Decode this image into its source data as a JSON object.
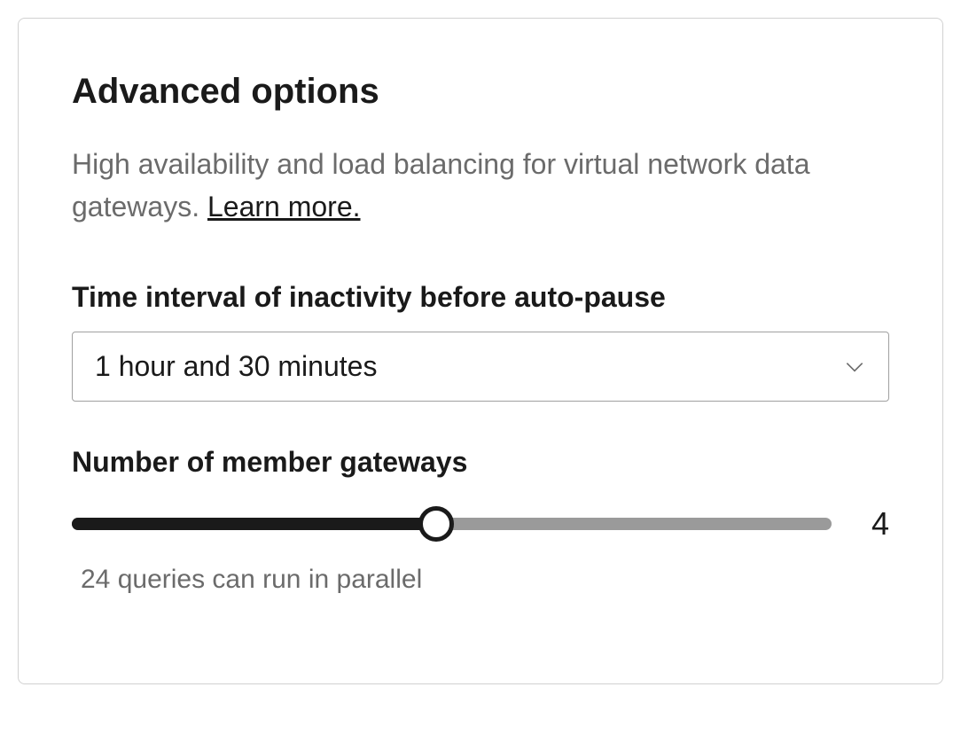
{
  "card": {
    "title": "Advanced options",
    "description_prefix": "High availability and load balancing for virtual network data gateways. ",
    "learn_more_label": "Learn more."
  },
  "time_interval": {
    "label": "Time interval of inactivity before auto-pause",
    "selected_value": "1 hour and 30 minutes"
  },
  "member_gateways": {
    "label": "Number of member gateways",
    "value": "4",
    "helper_text": "24 queries can run in parallel"
  }
}
